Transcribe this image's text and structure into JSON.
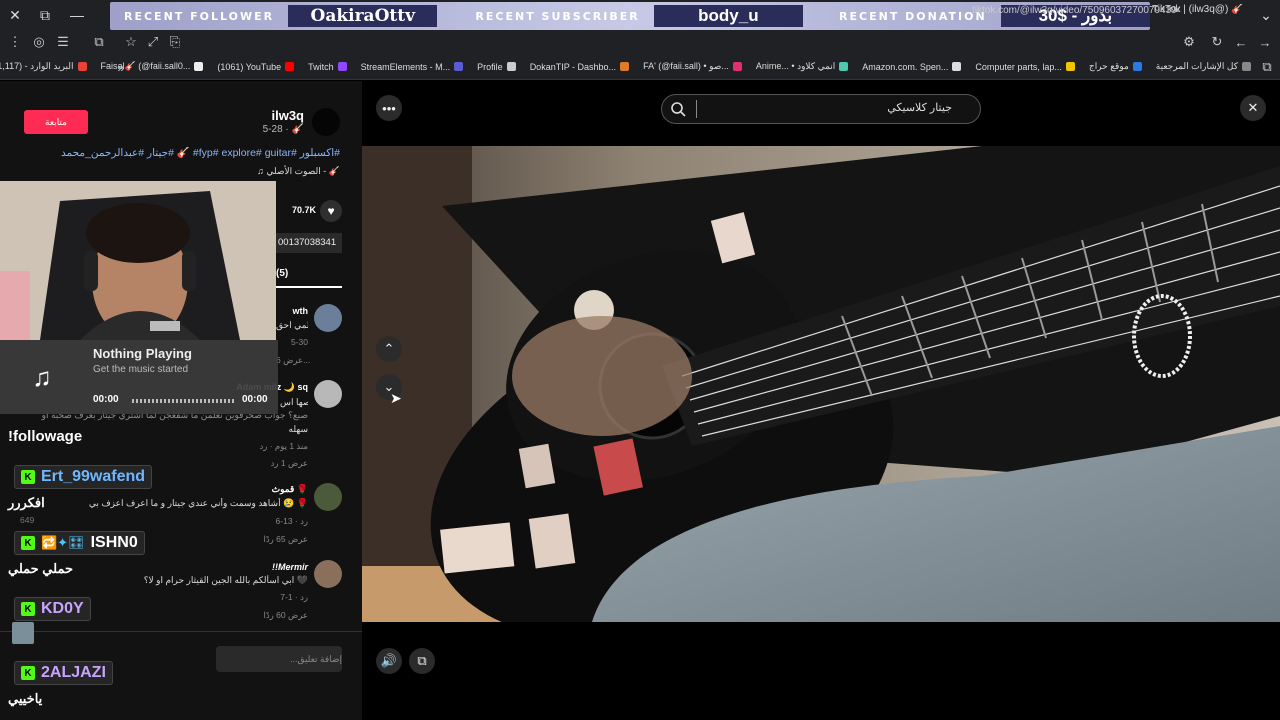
{
  "overlay": {
    "follower_label": "RECENT FOLLOWER",
    "follower_value": "OakiraOttv",
    "subscriber_label": "RECENT SUBSCRIBER",
    "subscriber_value": "body_u",
    "donation_label": "RECENT DONATION",
    "donation_value": "30$ - بدور"
  },
  "browser": {
    "tab_title": "TikTok | (ilw3q@) 🎸",
    "url": "tiktok.com/@ilw3q/video/7509603727007943943",
    "bookmarks": [
      {
        "label": "كل الإشارات المرجعية",
        "color": "#888"
      },
      {
        "label": "موقع حراج",
        "color": "#2a7ae2"
      },
      {
        "label": "Computer parts, lap...",
        "color": "#f5c400"
      },
      {
        "label": "Amazon.com. Spen...",
        "color": "#ddd"
      },
      {
        "label": "Anime... • انمي كلاود",
        "color": "#4ec9b0"
      },
      {
        "label": "FA' (@faii.sall) • صو...",
        "color": "#e1306c"
      },
      {
        "label": "DokanTIP - Dashbo...",
        "color": "#e07b2a"
      },
      {
        "label": "Profile",
        "color": "#ccc"
      },
      {
        "label": "StreamElements - M...",
        "color": "#5b5bd6"
      },
      {
        "label": "Twitch",
        "color": "#9146ff"
      },
      {
        "label": "(1061) YouTube",
        "color": "#ff0000"
      },
      {
        "label": "Faisal🎸 (@faii.sall0...",
        "color": "#eee"
      },
      {
        "label": "البريد الوارد - (1,117)",
        "color": "#ea4335"
      }
    ]
  },
  "post": {
    "follow_label": "متابعة",
    "creator": "ilw3q",
    "date": "5-28 · 🎸",
    "caption": "#اكسبلور #fyp# explore# guitar# 🎸 #جيتار #عبدالرحمن_محمد",
    "sound": "🎸 - الصوت الأصلي ♫",
    "likes": "70.7K",
    "link_fragment": "00137038341",
    "comments_tab": "(5)"
  },
  "comments": [
    {
      "name": "wth",
      "text": "حلمي احق...",
      "meta": "5-30",
      "replies": "عرض 6..."
    },
    {
      "name": "Adam milz 🌙 sq",
      "text": "احصها اس...",
      "text2": "صبع؟ جواب صحرفوين نعلمن ما شفعجن لما اشتري جيتار بعرف صحبه او",
      "text3": "سهله",
      "meta": "منذ 1 يوم · رد",
      "replies": "عرض 1 رد"
    },
    {
      "name": "قموث 🌹",
      "text": "أشاهد وسمت وأني عندي جيتار و ما اعرف اعزف بي 😢 🌹",
      "meta": "6-13 · رد",
      "replies": "عرض 65 ردًا"
    },
    {
      "name": "!!Mermir",
      "text": "ابي اسألكم بالله الجين القيثار حرام او لا؟ 🖤",
      "meta": "7-1 · رد",
      "replies": "عرض 60 ردًا"
    }
  ],
  "comment_placeholder": "إضافة تعليق...",
  "music": {
    "title": "Nothing Playing",
    "subtitle": "Get the music started",
    "time_start": "00:00",
    "time_end": "00:00"
  },
  "chat": {
    "command": "!followage",
    "messages": [
      {
        "user": "Ert_99wafend",
        "color": "#6fb8ff",
        "text": "افكررر"
      },
      {
        "user": "ISHN0",
        "color": "#ffffff",
        "badges": "🔁✦🎛",
        "text": "حملي حملي"
      },
      {
        "user": "KD0Y",
        "color": "#c8a4ff",
        "text": ""
      },
      {
        "user": "2ALJAZI",
        "color": "#c8a4ff",
        "text": "ياخييي"
      }
    ],
    "stat": "649"
  },
  "search": {
    "value": "جيتار كلاسيكي"
  }
}
